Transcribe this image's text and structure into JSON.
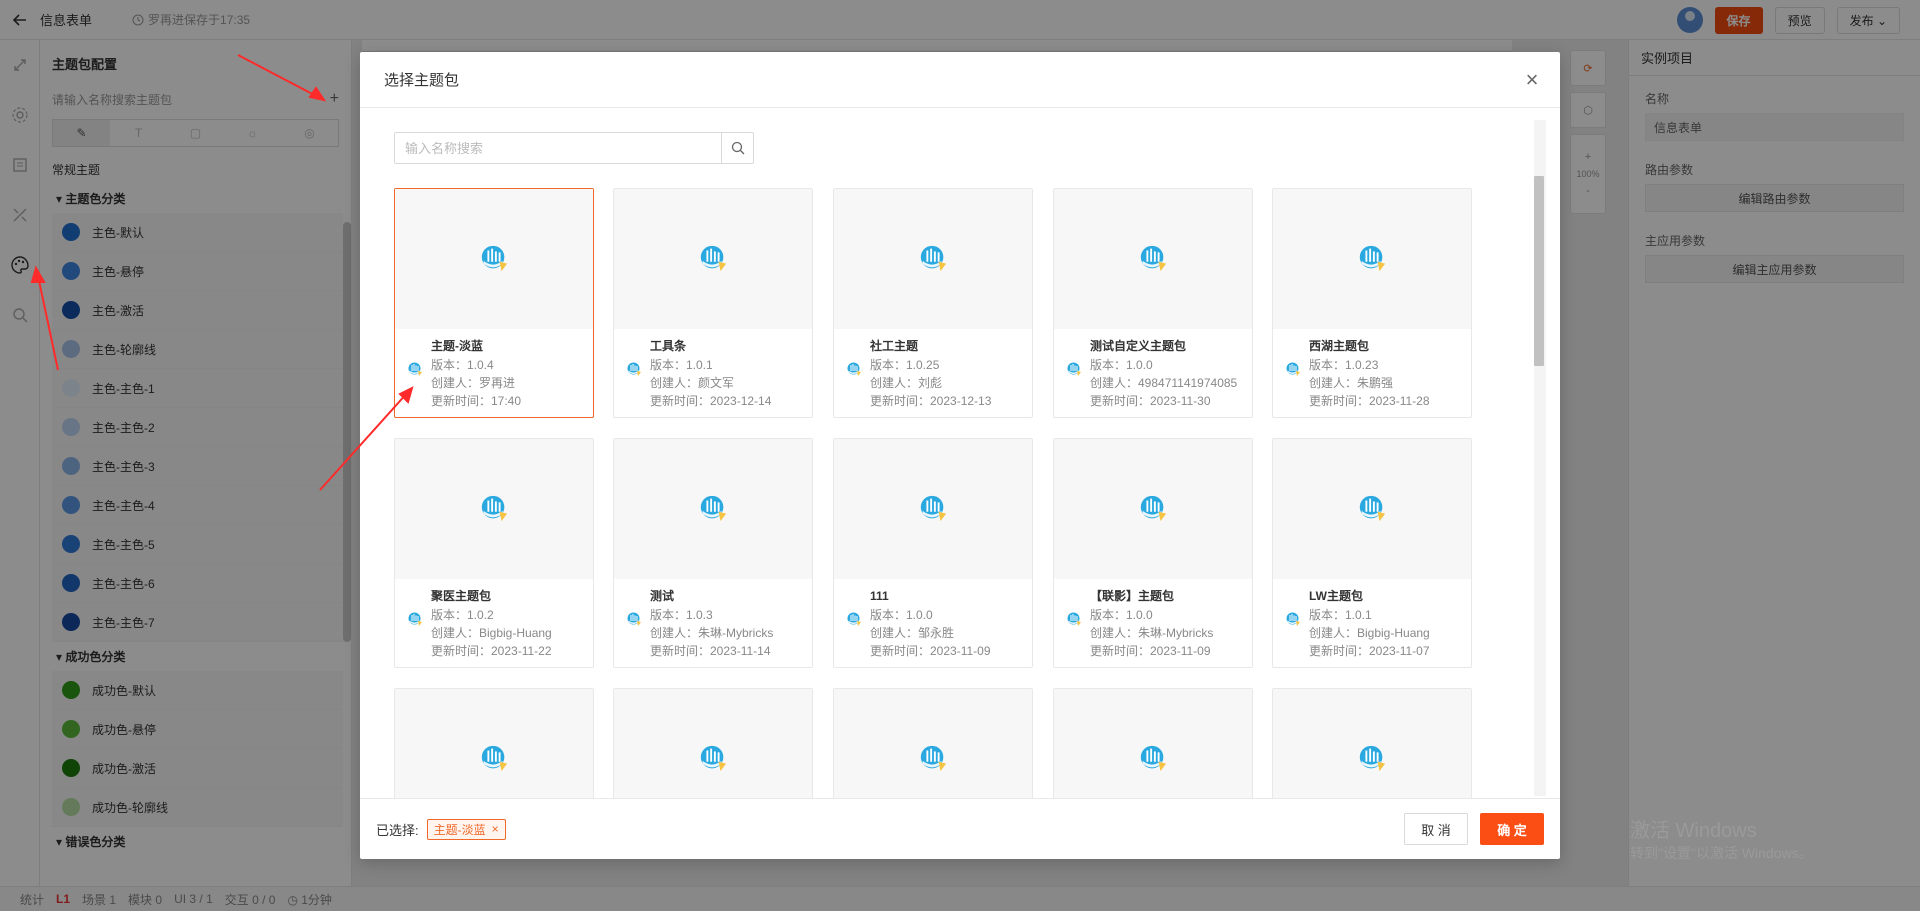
{
  "app": {
    "title": "信息表单",
    "saved_text": "罗再进保存于17:35",
    "save_label": "保存",
    "preview_label": "预览",
    "publish_label": "发布"
  },
  "left_panel": {
    "title": "主题包配置",
    "search_placeholder": "请输入名称搜索主题包",
    "section": "常规主题",
    "groups": [
      {
        "label": "主题色分类",
        "items": [
          {
            "label": "主色-默认",
            "color": "#1f6fd1"
          },
          {
            "label": "主色-悬停",
            "color": "#3d86e0"
          },
          {
            "label": "主色-激活",
            "color": "#134fa6"
          },
          {
            "label": "主色-轮廓线",
            "color": "#a9c3ea"
          },
          {
            "label": "主色-主色-1",
            "color": "#e3eefb"
          },
          {
            "label": "主色-主色-2",
            "color": "#bcd6f4"
          },
          {
            "label": "主色-主色-3",
            "color": "#8cb7ec"
          },
          {
            "label": "主色-主色-4",
            "color": "#5c97e3"
          },
          {
            "label": "主色-主色-5",
            "color": "#2e78d9"
          },
          {
            "label": "主色-主色-6",
            "color": "#1f64c4"
          },
          {
            "label": "主色-主色-7",
            "color": "#1449a0"
          }
        ]
      },
      {
        "label": "成功色分类",
        "items": [
          {
            "label": "成功色-默认",
            "color": "#2f9b18"
          },
          {
            "label": "成功色-悬停",
            "color": "#5cb93a"
          },
          {
            "label": "成功色-激活",
            "color": "#1e7a0c"
          },
          {
            "label": "成功色-轮廓线",
            "color": "#b6dfa6"
          }
        ]
      },
      {
        "label": "错误色分类",
        "items": []
      }
    ]
  },
  "right_panel": {
    "tab": "实例项目",
    "name_label": "名称",
    "name_value": "信息表单",
    "route_label": "路由参数",
    "route_btn": "编辑路由参数",
    "main_label": "主应用参数",
    "main_btn": "编辑主应用参数"
  },
  "canvas_tools": {
    "zoom_in": "+",
    "zoom": "100%",
    "zoom_out": "-"
  },
  "watermark": {
    "line1": "激活 Windows",
    "line2": "转到\"设置\"以激活 Windows。"
  },
  "status_bar": {
    "stats": "统计",
    "level": "L1",
    "scene": "场景 1",
    "module": "模块 0",
    "ui": "UI 3 / 1",
    "interaction": "交互 0 / 0",
    "time": "1分钟"
  },
  "modal": {
    "title": "选择主题包",
    "search_placeholder": "输入名称搜索",
    "selected_label": "已选择:",
    "selected_tag": "主题-淡蓝",
    "cancel_label": "取 消",
    "ok_label": "确 定",
    "cards": [
      {
        "name": "主题-淡蓝",
        "version": "版本：1.0.4",
        "creator": "创建人：罗再进",
        "updated": "更新时间：17:40",
        "selected": true
      },
      {
        "name": "工具条",
        "version": "版本：1.0.1",
        "creator": "创建人：颜文军",
        "updated": "更新时间：2023-12-14"
      },
      {
        "name": "社工主题",
        "version": "版本：1.0.25",
        "creator": "创建人：刘彪",
        "updated": "更新时间：2023-12-13"
      },
      {
        "name": "测试自定义主题包",
        "version": "版本：1.0.0",
        "creator": "创建人：498471141974085",
        "updated": "更新时间：2023-11-30"
      },
      {
        "name": "西湖主题包",
        "version": "版本：1.0.23",
        "creator": "创建人：朱鹏强",
        "updated": "更新时间：2023-11-28"
      },
      {
        "name": "聚医主题包",
        "version": "版本：1.0.2",
        "creator": "创建人：Bigbig-Huang",
        "updated": "更新时间：2023-11-22"
      },
      {
        "name": "测试",
        "version": "版本：1.0.3",
        "creator": "创建人：朱琳-Mybricks",
        "updated": "更新时间：2023-11-14"
      },
      {
        "name": "111",
        "version": "版本：1.0.0",
        "creator": "创建人：邹永胜",
        "updated": "更新时间：2023-11-09"
      },
      {
        "name": "【联影】主题包",
        "version": "版本：1.0.0",
        "creator": "创建人：朱琳-Mybricks",
        "updated": "更新时间：2023-11-09"
      },
      {
        "name": "LW主题包",
        "version": "版本：1.0.1",
        "creator": "创建人：Bigbig-Huang",
        "updated": "更新时间：2023-11-07"
      },
      {
        "name": "",
        "version": "",
        "creator": "",
        "updated": ""
      },
      {
        "name": "",
        "version": "",
        "creator": "",
        "updated": ""
      },
      {
        "name": "",
        "version": "",
        "creator": "",
        "updated": ""
      },
      {
        "name": "",
        "version": "",
        "creator": "",
        "updated": ""
      },
      {
        "name": "",
        "version": "",
        "creator": "",
        "updated": ""
      }
    ]
  },
  "colors": {
    "accent": "#f24b11",
    "selected_border": "#f0692a",
    "arrow": "#ff2a2a"
  }
}
